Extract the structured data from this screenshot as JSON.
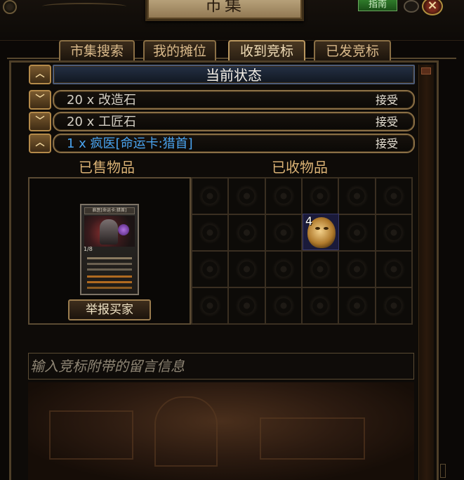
{
  "window": {
    "title": "市集",
    "guide_label": "指南",
    "close_label": "×"
  },
  "tabs": [
    {
      "label": "市集搜索",
      "active": false
    },
    {
      "label": "我的摊位",
      "active": false
    },
    {
      "label": "收到竞标",
      "active": true
    },
    {
      "label": "已发竞标",
      "active": false
    }
  ],
  "status": {
    "label": "当前状态"
  },
  "offers": [
    {
      "text": "20 x 改造石",
      "accept": "接受",
      "color": "#d4cfc4"
    },
    {
      "text": "20 x 工匠石",
      "accept": "接受",
      "color": "#d4cfc4"
    },
    {
      "text": "1 x 疯医[命运卡:猎首]",
      "accept": "接受",
      "color": "#4aa4f0"
    }
  ],
  "sold": {
    "heading": "已售物品",
    "card": {
      "name": "疯医[命运卡:猎首]",
      "stack": "1/8"
    },
    "report_label": "举报买家"
  },
  "received": {
    "heading": "已收物品",
    "item": {
      "icon": "golden-mask-icon",
      "quantity": "4"
    }
  },
  "message": {
    "placeholder": "输入竞标附带的留言信息"
  }
}
